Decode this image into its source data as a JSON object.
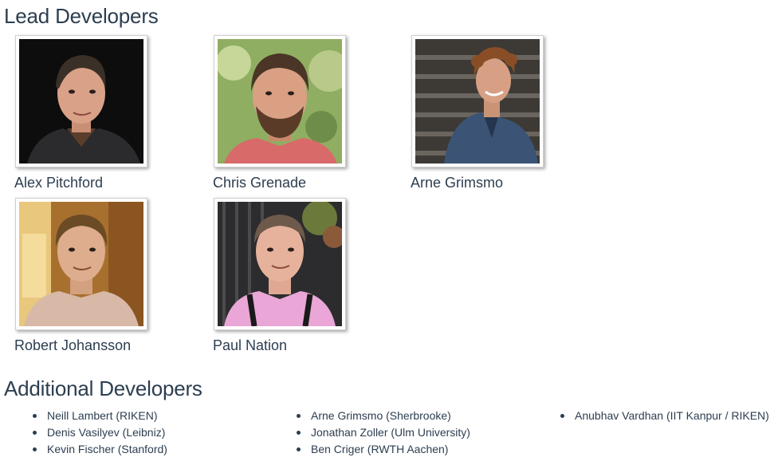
{
  "lead_developers": {
    "title": "Lead Developers",
    "people": [
      {
        "name": "Alex Pitchford"
      },
      {
        "name": "Chris Grenade"
      },
      {
        "name": "Arne Grimsmo"
      },
      {
        "name": "Robert Johansson"
      },
      {
        "name": "Paul Nation"
      }
    ]
  },
  "additional_developers": {
    "title": "Additional Developers",
    "columns": [
      [
        "Neill Lambert (RIKEN)",
        "Denis Vasilyev (Leibniz)",
        "Kevin Fischer (Stanford)"
      ],
      [
        "Arne Grimsmo (Sherbrooke)",
        "Jonathan Zoller (Ulm University)",
        "Ben Criger (RWTH Aachen)"
      ],
      [
        "Anubhav Vardhan (IIT Kanpur / RIKEN)"
      ]
    ]
  },
  "colors": {
    "text": "#2c3e50",
    "frame_border": "#cfcfcf",
    "background": "#ffffff"
  }
}
